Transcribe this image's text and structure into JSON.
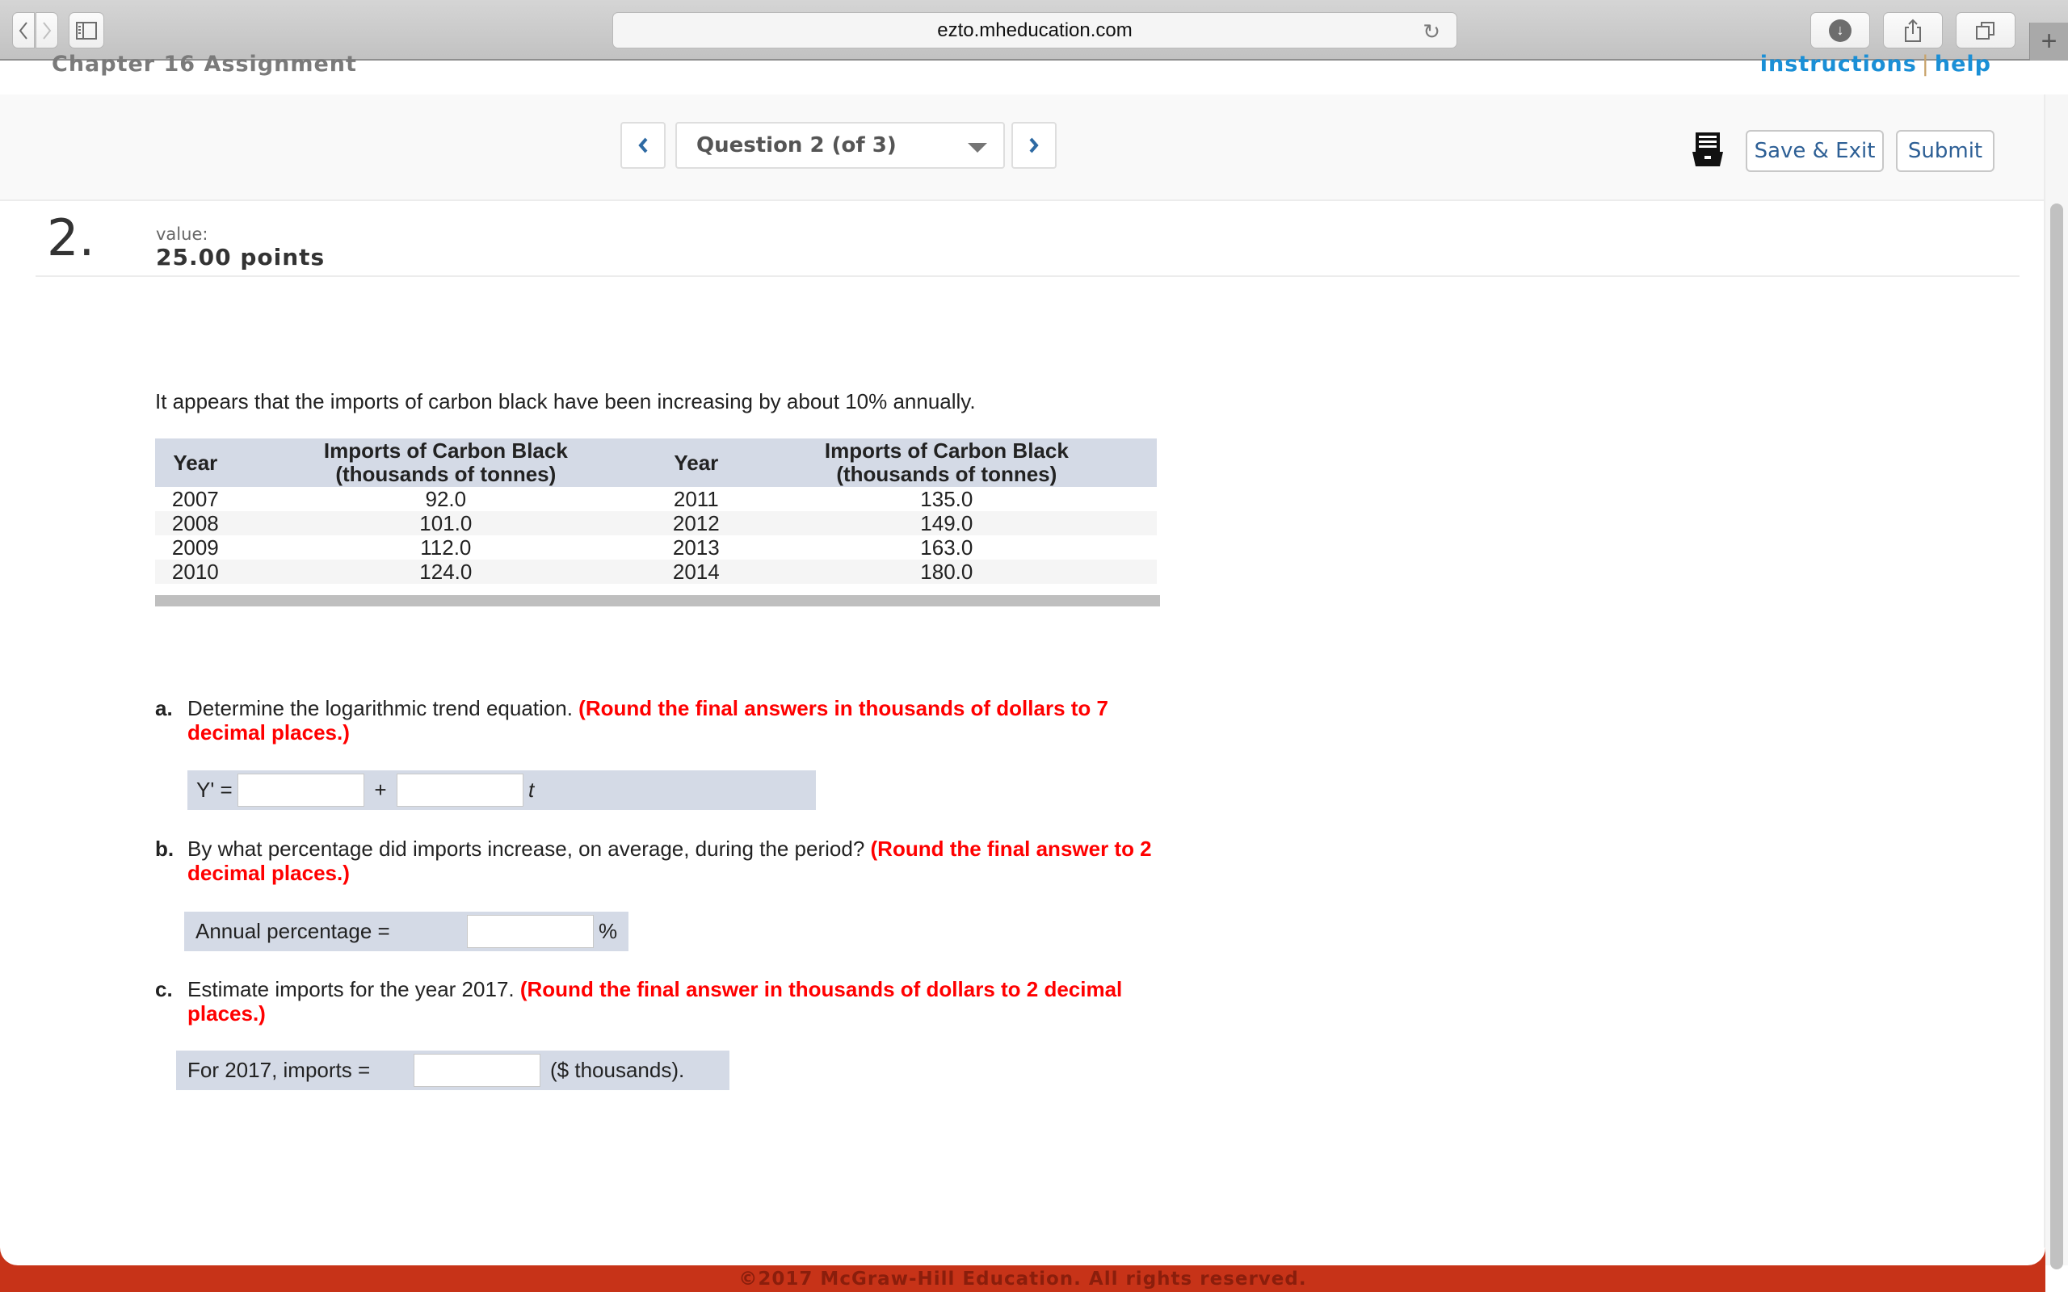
{
  "browser": {
    "url": "ezto.mheducation.com",
    "icons": {
      "back": "chevron-left-icon",
      "forward": "chevron-right-icon",
      "sidebar": "sidebar-icon",
      "reload": "reload-icon",
      "download": "download-icon",
      "share": "share-icon",
      "tabs": "tabs-icon",
      "new_tab": "plus-icon"
    }
  },
  "header": {
    "assignment_title": "Chapter 16 Assignment",
    "links": {
      "instructions": "instructions",
      "separator": "|",
      "help": "help"
    }
  },
  "navigation": {
    "prev_label": "‹",
    "next_label": "›",
    "question_selector": "Question 2 (of 3)",
    "print_icon": "print-icon",
    "save_exit_label": "Save & Exit",
    "submit_label": "Submit"
  },
  "question": {
    "number": "2.",
    "value_label": "value:",
    "points": "25.00 points",
    "intro": "It appears that the imports of carbon black have been increasing by about 10% annually.",
    "table": {
      "headers": [
        "Year",
        "Imports of Carbon Black (thousands of tonnes)",
        "Year",
        "Imports of Carbon Black (thousands of tonnes)"
      ],
      "header_lines": {
        "year": "Year",
        "imports_line1": "Imports of Carbon Black",
        "imports_line2": "(thousands of tonnes)"
      },
      "rows": [
        [
          "2007",
          "92.0",
          "2011",
          "135.0"
        ],
        [
          "2008",
          "101.0",
          "2012",
          "149.0"
        ],
        [
          "2009",
          "112.0",
          "2013",
          "163.0"
        ],
        [
          "2010",
          "124.0",
          "2014",
          "180.0"
        ]
      ]
    },
    "parts": {
      "a": {
        "letter": "a.",
        "text": "Determine the logarithmic trend equation. ",
        "hint": "(Round the final answers in thousands of dollars to 7 decimal places.)",
        "prefix": "Y' =",
        "plus": "+",
        "suffix": "t",
        "input1_value": "",
        "input2_value": ""
      },
      "b": {
        "letter": "b.",
        "text": "By what percentage did imports increase, on average, during the period? ",
        "hint": "(Round the final answer to 2 decimal places.)",
        "label": "Annual percentage =",
        "suffix": "%",
        "input_value": ""
      },
      "c": {
        "letter": "c.",
        "text": "Estimate imports for the year 2017. ",
        "hint": "(Round the final answer in thousands of dollars to 2 decimal places.)",
        "label": "For 2017, imports =",
        "suffix": "($ thousands).",
        "input_value": ""
      }
    }
  },
  "footer": {
    "copyright": "©2017 McGraw-Hill Education. All rights reserved."
  },
  "colors": {
    "accent_link": "#1a8fd6",
    "button_text": "#2d5f95",
    "hint_red": "#ff0000",
    "answer_band": "#d4dae6",
    "footer_bg": "#c73318"
  }
}
